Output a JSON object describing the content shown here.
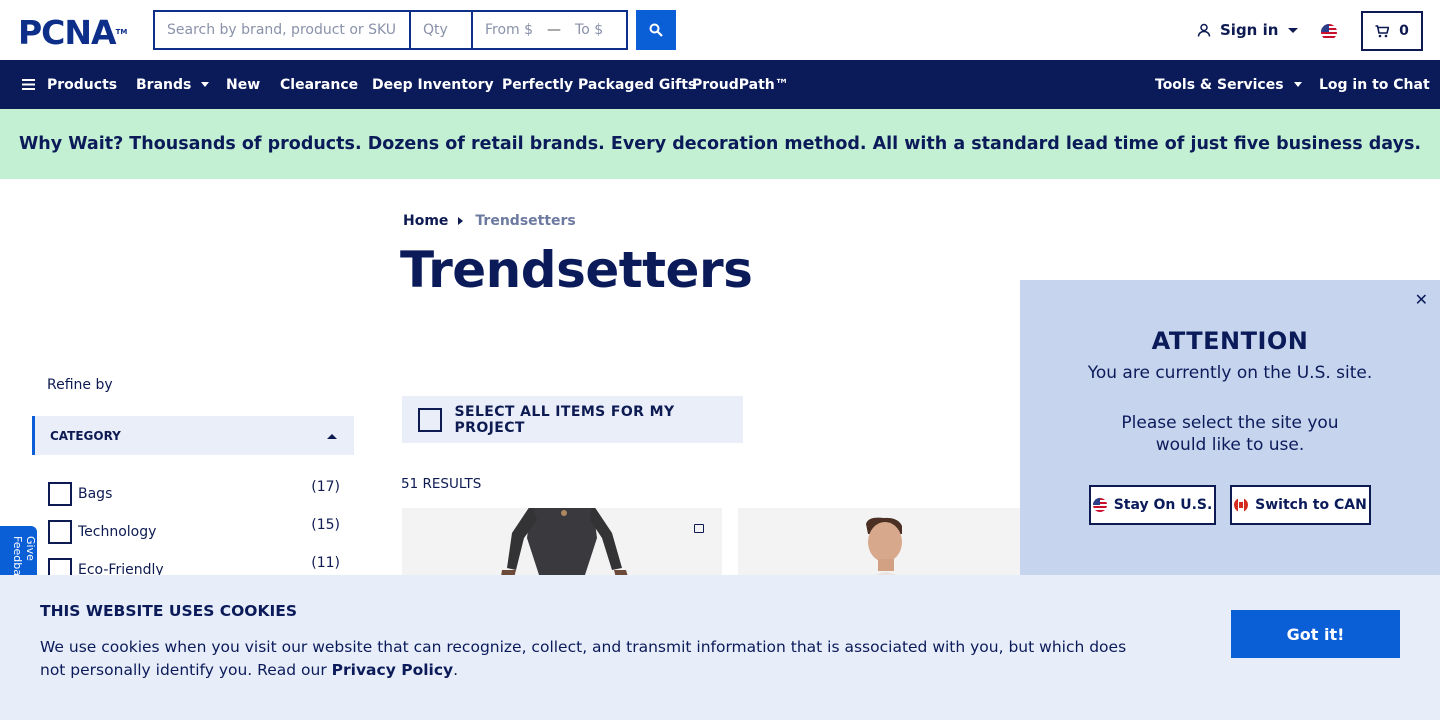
{
  "header": {
    "logo": "PCNA",
    "logo_tm": "TM",
    "search_placeholder": "Search by brand, product or SKU",
    "qty_placeholder": "Qty",
    "price_from_placeholder": "From $",
    "price_to_placeholder": "To $",
    "sign_in": "Sign in",
    "cart_count": "0"
  },
  "nav": {
    "products": "Products",
    "brands": "Brands",
    "new": "New",
    "clearance": "Clearance",
    "deep_inventory": "Deep Inventory",
    "gifts": "Perfectly Packaged Gifts",
    "proudpath": "ProudPath™",
    "tools": "Tools & Services",
    "chat": "Log in to Chat"
  },
  "promo": "Why Wait? Thousands of products. Dozens of retail brands. Every decoration method. All with a standard lead time of just five business days.",
  "breadcrumb": {
    "home": "Home",
    "current": "Trendsetters"
  },
  "page_title": "Trendsetters",
  "sidebar": {
    "refine_by": "Refine by",
    "category_header": "CATEGORY",
    "categories": [
      {
        "label": "Bags",
        "count": "(17)"
      },
      {
        "label": "Technology",
        "count": "(15)"
      },
      {
        "label": "Eco-Friendly",
        "count": "(11)"
      }
    ],
    "feedback": "Give Feedback"
  },
  "main": {
    "select_all": "SELECT ALL ITEMS FOR MY PROJECT",
    "results": "51 RESULTS"
  },
  "modal": {
    "title": "ATTENTION",
    "line1": "You are currently on the U.S. site.",
    "line2": "Please select the site you would like to use.",
    "stay_us": "Stay On U.S.",
    "switch_can": "Switch to CAN"
  },
  "cookie": {
    "title": "THIS WEBSITE USES COOKIES",
    "text": "We use cookies when you visit our website that can recognize, collect, and transmit information that is associated with you, but which does not personally identify you. Read our ",
    "link": "Privacy Policy",
    "text_end": ".",
    "button": "Got it!"
  },
  "colors": {
    "brand_navy": "#0b1b5a",
    "accent_blue": "#0a5fd6",
    "promo_green": "#c3efd2",
    "panel_blue": "#e9eef9",
    "modal_blue": "#c6d4ee"
  }
}
